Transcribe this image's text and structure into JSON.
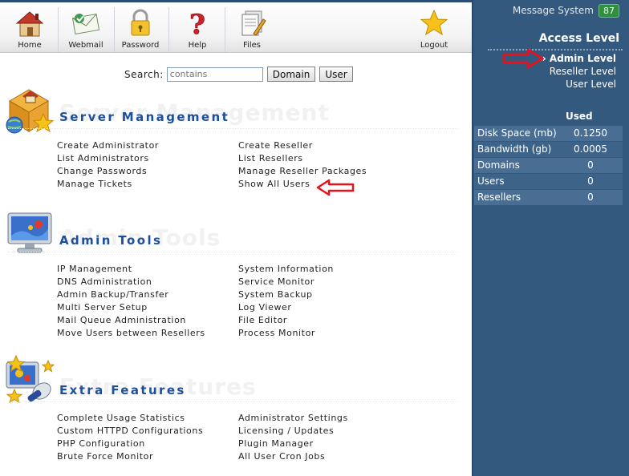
{
  "toolbar": {
    "home": "Home",
    "webmail": "Webmail",
    "password": "Password",
    "help": "Help",
    "files": "Files",
    "logout": "Logout"
  },
  "search": {
    "label": "Search:",
    "placeholder": "contains",
    "domain_button": "Domain",
    "user_button": "User"
  },
  "sections": {
    "server": {
      "title": "Server Management",
      "col1": [
        "Create Administrator",
        "List Administrators",
        "Change Passwords",
        "Manage Tickets"
      ],
      "col2": [
        "Create Reseller",
        "List Resellers",
        "Manage Reseller Packages",
        "Show All Users"
      ]
    },
    "admin": {
      "title": "Admin Tools",
      "col1": [
        "IP Management",
        "DNS Administration",
        "Admin Backup/Transfer",
        "Multi Server Setup",
        "Mail Queue Administration",
        "Move Users between Resellers"
      ],
      "col2": [
        "System Information",
        "Service Monitor",
        "System Backup",
        "Log Viewer",
        "File Editor",
        "Process Monitor"
      ]
    },
    "extra": {
      "title": "Extra Features",
      "col1": [
        "Complete Usage Statistics",
        "Custom HTTPD Configurations",
        "PHP Configuration",
        "Brute Force Monitor"
      ],
      "col2": [
        "Administrator Settings",
        "Licensing / Updates",
        "Plugin Manager",
        "All User Cron Jobs"
      ]
    }
  },
  "sidebar": {
    "message_system": "Message System",
    "message_count": "87",
    "access_level_title": "Access Level",
    "admin_level": "» Admin Level",
    "reseller_level": "Reseller Level",
    "user_level": "User Level",
    "used_header": "Used",
    "usage": [
      {
        "label": "Disk Space (mb)",
        "value": "0.1250"
      },
      {
        "label": "Bandwidth (gb)",
        "value": "0.0005"
      },
      {
        "label": "Domains",
        "value": "0"
      },
      {
        "label": "Users",
        "value": "0"
      },
      {
        "label": "Resellers",
        "value": "0"
      }
    ]
  },
  "colors": {
    "sidebar_bg": "#34597f",
    "section_title": "#1d4f9d",
    "annotation_arrow": "#e8121c"
  }
}
